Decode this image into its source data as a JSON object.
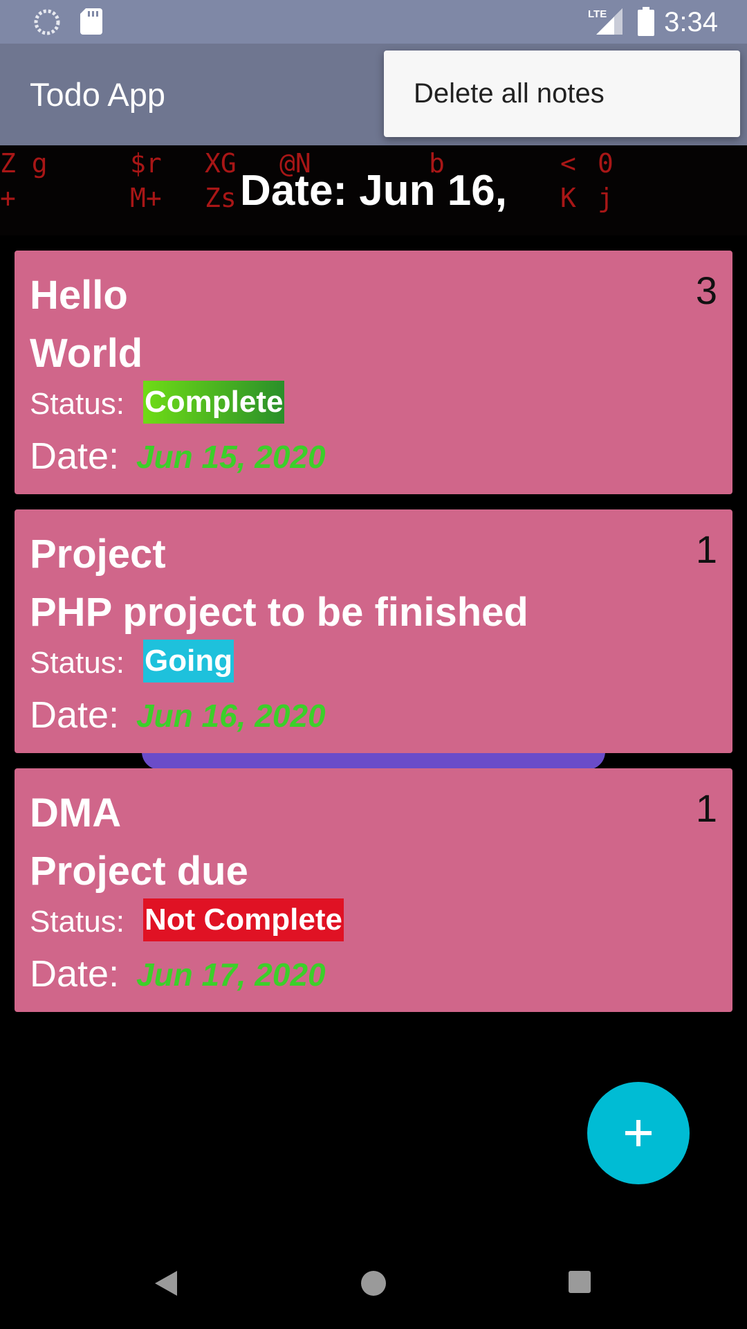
{
  "status_bar": {
    "time": "3:34",
    "network_label": "LTE",
    "icons": [
      "sync-icon",
      "sd-card-icon",
      "lte-signal-icon",
      "battery-icon"
    ]
  },
  "app_bar": {
    "title": "Todo App"
  },
  "overflow_menu": {
    "items": [
      {
        "label": "Delete all notes"
      }
    ]
  },
  "header": {
    "date_text": "Date: Jun 16,"
  },
  "notes": [
    {
      "title": "Hello",
      "description": "World",
      "count": "3",
      "status_label": "Status:",
      "status": "Complete",
      "status_color": "#3aa826",
      "date_label": "Date:",
      "date": "Jun 15, 2020"
    },
    {
      "title": "Project",
      "description": "PHP project to be finished",
      "count": "1",
      "status_label": "Status:",
      "status": "Going",
      "status_color": "#1ec1dc",
      "date_label": "Date:",
      "date": "Jun 16, 2020"
    },
    {
      "title": "DMA",
      "description": "Project due",
      "count": "1",
      "status_label": "Status:",
      "status": "Not Complete",
      "status_color": "#e01224",
      "date_label": "Date:",
      "date": "Jun 17, 2020"
    }
  ],
  "fab": {
    "icon": "plus-icon",
    "color": "#00bcd4"
  },
  "nav_bar": {
    "icons": [
      "back-icon",
      "home-icon",
      "recents-icon"
    ]
  },
  "colors": {
    "status_bar": "#7f88a6",
    "app_bar": "#6f7690",
    "card": "#d0668a",
    "date_value": "#3ccf2a"
  }
}
